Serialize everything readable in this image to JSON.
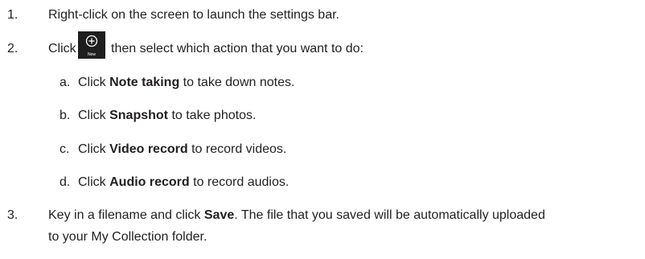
{
  "steps": [
    {
      "number": "1.",
      "text": "Right-click on the screen to launch the settings bar."
    },
    {
      "number": "2.",
      "text_before": "Click",
      "text_after": "then select which action that you want to do:",
      "icon": {
        "name": "new-plus-icon",
        "label": "New"
      },
      "substeps": [
        {
          "letter": "a.",
          "pre": "Click ",
          "bold": "Note taking",
          "post": " to take down notes."
        },
        {
          "letter": "b.",
          "pre": "Click ",
          "bold": "Snapshot",
          "post": " to take photos."
        },
        {
          "letter": "c.",
          "pre": "Click ",
          "bold": "Video record",
          "post": " to record videos."
        },
        {
          "letter": "d.",
          "pre": "Click ",
          "bold": "Audio record",
          "post": " to record audios."
        }
      ]
    },
    {
      "number": "3.",
      "pre": "Key in a filename and click ",
      "bold": "Save",
      "post": ". The file that you saved will be automatically uploaded",
      "line2": "to your My Collection folder."
    }
  ],
  "colors": {
    "text": "#231f20",
    "icon_background": "#1e1e1e",
    "icon_foreground": "#ffffff"
  }
}
